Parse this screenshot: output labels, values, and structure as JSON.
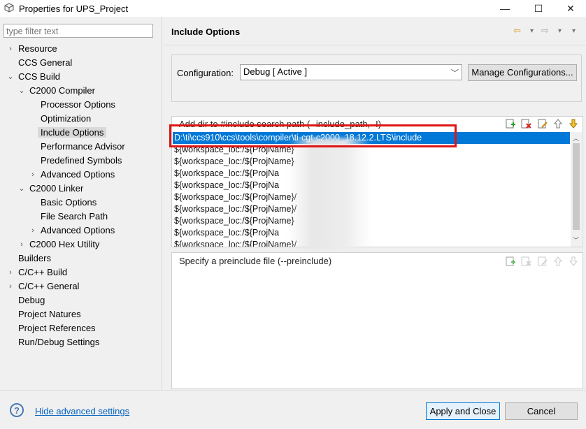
{
  "window": {
    "title": "Properties for UPS_Project",
    "minimize": "—",
    "maximize": "☐",
    "close": "✕"
  },
  "filter": {
    "placeholder": "type filter text"
  },
  "tree": [
    {
      "label": "Resource",
      "level": 0,
      "twisty": "›"
    },
    {
      "label": "CCS General",
      "level": 0,
      "twisty": ""
    },
    {
      "label": "CCS Build",
      "level": 0,
      "twisty": "⌄"
    },
    {
      "label": "C2000 Compiler",
      "level": 1,
      "twisty": "⌄"
    },
    {
      "label": "Processor Options",
      "level": 2,
      "twisty": ""
    },
    {
      "label": "Optimization",
      "level": 2,
      "twisty": ""
    },
    {
      "label": "Include Options",
      "level": 2,
      "twisty": "",
      "selected": true
    },
    {
      "label": "Performance Advisor",
      "level": 2,
      "twisty": ""
    },
    {
      "label": "Predefined Symbols",
      "level": 2,
      "twisty": ""
    },
    {
      "label": "Advanced Options",
      "level": 2,
      "twisty": "›"
    },
    {
      "label": "C2000 Linker",
      "level": 1,
      "twisty": "⌄"
    },
    {
      "label": "Basic Options",
      "level": 2,
      "twisty": ""
    },
    {
      "label": "File Search Path",
      "level": 2,
      "twisty": ""
    },
    {
      "label": "Advanced Options",
      "level": 2,
      "twisty": "›"
    },
    {
      "label": "C2000 Hex Utility",
      "level": 1,
      "twisty": "›"
    },
    {
      "label": "Builders",
      "level": 0,
      "twisty": ""
    },
    {
      "label": "C/C++ Build",
      "level": 0,
      "twisty": "›"
    },
    {
      "label": "C/C++ General",
      "level": 0,
      "twisty": "›"
    },
    {
      "label": "Debug",
      "level": 0,
      "twisty": ""
    },
    {
      "label": "Project Natures",
      "level": 0,
      "twisty": ""
    },
    {
      "label": "Project References",
      "level": 0,
      "twisty": ""
    },
    {
      "label": "Run/Debug Settings",
      "level": 0,
      "twisty": ""
    }
  ],
  "header": {
    "title": "Include Options",
    "back_icon": "⇦",
    "forward_icon": "⇨",
    "menu_icon": "▾"
  },
  "config": {
    "label": "Configuration:",
    "value": "Debug  [ Active ]",
    "manage_label": "Manage Configurations..."
  },
  "include_panel": {
    "heading": "Add dir to #include search path (--include_path, -I)",
    "items": [
      "D:\\ti\\ccs910\\ccs\\tools\\compiler\\ti-cgt-c2000_18.12.2.LTS\\include",
      "${workspace_loc:/${ProjName}",
      "${workspace_loc:/${ProjName}",
      "${workspace_loc:/${ProjNa",
      "${workspace_loc:/${ProjNa",
      "${workspace_loc:/${ProjName}/",
      "${workspace_loc:/${ProjName}/",
      "${workspace_loc:/${ProjName}",
      "${workspace_loc:/${ProjNa",
      "${workspace_loc:/${ProjName}/"
    ]
  },
  "preinclude_panel": {
    "heading": "Specify a preinclude file (--preinclude)"
  },
  "footer": {
    "help_icon": "?",
    "hide_advanced": "Hide advanced settings",
    "apply_label": "Apply and Close",
    "cancel_label": "Cancel"
  }
}
